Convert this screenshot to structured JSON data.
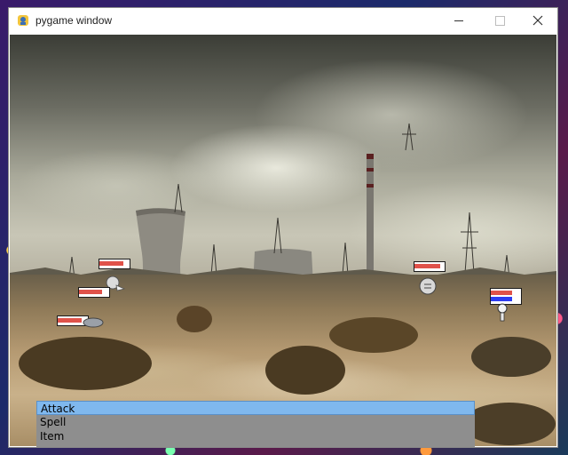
{
  "window": {
    "title": "pygame window",
    "icon": "pygame-snake-icon",
    "controls": [
      "minimize-icon",
      "maximize-icon",
      "close-icon"
    ]
  },
  "battle": {
    "scene": "post-apocalyptic wasteland with cooling towers",
    "player_party": [
      {
        "name": "",
        "hp_fraction": 0.8,
        "mp_fraction": 0.0,
        "icon": "white-knight-sprite"
      },
      {
        "name": "",
        "hp_fraction": 0.75,
        "mp_fraction": 0.0,
        "icon": "grey-blob-sprite"
      }
    ],
    "enemies": [
      {
        "name": "",
        "hp_fraction": 0.85,
        "icon": "white-orb-sprite"
      },
      {
        "name": "",
        "hp_fraction": 0.7,
        "mp_fraction": 0.7,
        "icon": "skeleton-sprite"
      }
    ],
    "colors": {
      "hp": "#e0524a",
      "mp": "#2d3cf0",
      "menu_bg": "#8e8e8e",
      "menu_selected": "#7fb8ee"
    }
  },
  "menu": {
    "items": [
      {
        "label": "Attack",
        "selected": true
      },
      {
        "label": "Spell",
        "selected": false
      },
      {
        "label": "Item",
        "selected": false
      }
    ]
  }
}
